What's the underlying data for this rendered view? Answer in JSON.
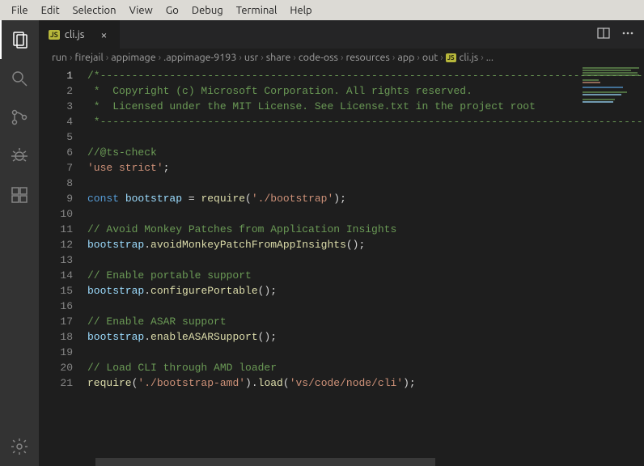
{
  "menubar": [
    "File",
    "Edit",
    "Selection",
    "View",
    "Go",
    "Debug",
    "Terminal",
    "Help"
  ],
  "tab": {
    "filename": "cli.js",
    "badge": "JS"
  },
  "breadcrumbs": [
    "run",
    "firejail",
    "appimage",
    ".appimage-9193",
    "usr",
    "share",
    "code-oss",
    "resources",
    "app",
    "out"
  ],
  "breadcrumb_file": {
    "badge": "JS",
    "name": "cli.js",
    "more": "..."
  },
  "line_count": 21,
  "current_line": 1,
  "code_lines": [
    [
      {
        "c": "cmt",
        "t": "/*---------------------------------------------------------------------------------------------"
      }
    ],
    [
      {
        "c": "cmt",
        "t": " *  Copyright (c) Microsoft Corporation. All rights reserved."
      }
    ],
    [
      {
        "c": "cmt",
        "t": " *  Licensed under the MIT License. See License.txt in the project root"
      }
    ],
    [
      {
        "c": "cmt",
        "t": " *--------------------------------------------------------------------------------------------*/"
      }
    ],
    [],
    [
      {
        "c": "cmt",
        "t": "//@ts-check"
      }
    ],
    [
      {
        "c": "str",
        "t": "'use strict'"
      },
      {
        "c": "punc",
        "t": ";"
      }
    ],
    [],
    [
      {
        "c": "kw",
        "t": "const "
      },
      {
        "c": "var",
        "t": "bootstrap"
      },
      {
        "c": "punc",
        "t": " = "
      },
      {
        "c": "fn",
        "t": "require"
      },
      {
        "c": "punc",
        "t": "("
      },
      {
        "c": "str",
        "t": "'./bootstrap'"
      },
      {
        "c": "punc",
        "t": ");"
      }
    ],
    [],
    [
      {
        "c": "cmt",
        "t": "// Avoid Monkey Patches from Application Insights"
      }
    ],
    [
      {
        "c": "var",
        "t": "bootstrap"
      },
      {
        "c": "punc",
        "t": "."
      },
      {
        "c": "fn",
        "t": "avoidMonkeyPatchFromAppInsights"
      },
      {
        "c": "punc",
        "t": "();"
      }
    ],
    [],
    [
      {
        "c": "cmt",
        "t": "// Enable portable support"
      }
    ],
    [
      {
        "c": "var",
        "t": "bootstrap"
      },
      {
        "c": "punc",
        "t": "."
      },
      {
        "c": "fn",
        "t": "configurePortable"
      },
      {
        "c": "punc",
        "t": "();"
      }
    ],
    [],
    [
      {
        "c": "cmt",
        "t": "// Enable ASAR support"
      }
    ],
    [
      {
        "c": "var",
        "t": "bootstrap"
      },
      {
        "c": "punc",
        "t": "."
      },
      {
        "c": "fn",
        "t": "enableASARSupport"
      },
      {
        "c": "punc",
        "t": "();"
      }
    ],
    [],
    [
      {
        "c": "cmt",
        "t": "// Load CLI through AMD loader"
      }
    ],
    [
      {
        "c": "fn",
        "t": "require"
      },
      {
        "c": "punc",
        "t": "("
      },
      {
        "c": "str",
        "t": "'./bootstrap-amd'"
      },
      {
        "c": "punc",
        "t": ")."
      },
      {
        "c": "fn",
        "t": "load"
      },
      {
        "c": "punc",
        "t": "("
      },
      {
        "c": "str",
        "t": "'vs/code/node/cli'"
      },
      {
        "c": "punc",
        "t": ");"
      }
    ]
  ]
}
